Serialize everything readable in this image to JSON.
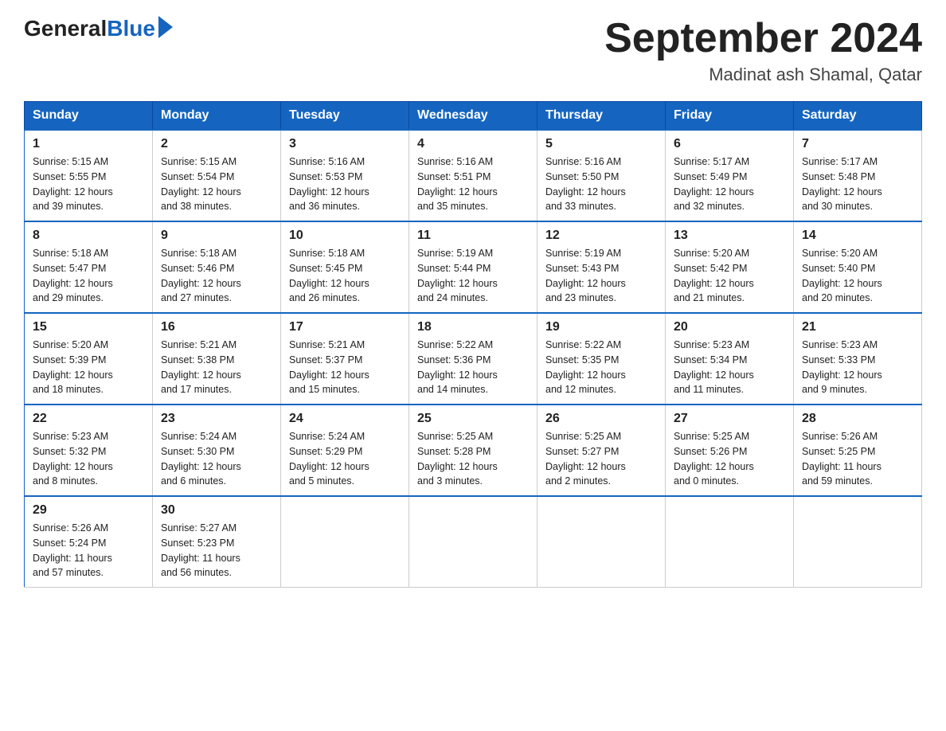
{
  "header": {
    "logo_general": "General",
    "logo_blue": "Blue",
    "month_title": "September 2024",
    "location": "Madinat ash Shamal, Qatar"
  },
  "days_of_week": [
    "Sunday",
    "Monday",
    "Tuesday",
    "Wednesday",
    "Thursday",
    "Friday",
    "Saturday"
  ],
  "weeks": [
    [
      {
        "day": "1",
        "sunrise": "5:15 AM",
        "sunset": "5:55 PM",
        "daylight": "12 hours and 39 minutes."
      },
      {
        "day": "2",
        "sunrise": "5:15 AM",
        "sunset": "5:54 PM",
        "daylight": "12 hours and 38 minutes."
      },
      {
        "day": "3",
        "sunrise": "5:16 AM",
        "sunset": "5:53 PM",
        "daylight": "12 hours and 36 minutes."
      },
      {
        "day": "4",
        "sunrise": "5:16 AM",
        "sunset": "5:51 PM",
        "daylight": "12 hours and 35 minutes."
      },
      {
        "day": "5",
        "sunrise": "5:16 AM",
        "sunset": "5:50 PM",
        "daylight": "12 hours and 33 minutes."
      },
      {
        "day": "6",
        "sunrise": "5:17 AM",
        "sunset": "5:49 PM",
        "daylight": "12 hours and 32 minutes."
      },
      {
        "day": "7",
        "sunrise": "5:17 AM",
        "sunset": "5:48 PM",
        "daylight": "12 hours and 30 minutes."
      }
    ],
    [
      {
        "day": "8",
        "sunrise": "5:18 AM",
        "sunset": "5:47 PM",
        "daylight": "12 hours and 29 minutes."
      },
      {
        "day": "9",
        "sunrise": "5:18 AM",
        "sunset": "5:46 PM",
        "daylight": "12 hours and 27 minutes."
      },
      {
        "day": "10",
        "sunrise": "5:18 AM",
        "sunset": "5:45 PM",
        "daylight": "12 hours and 26 minutes."
      },
      {
        "day": "11",
        "sunrise": "5:19 AM",
        "sunset": "5:44 PM",
        "daylight": "12 hours and 24 minutes."
      },
      {
        "day": "12",
        "sunrise": "5:19 AM",
        "sunset": "5:43 PM",
        "daylight": "12 hours and 23 minutes."
      },
      {
        "day": "13",
        "sunrise": "5:20 AM",
        "sunset": "5:42 PM",
        "daylight": "12 hours and 21 minutes."
      },
      {
        "day": "14",
        "sunrise": "5:20 AM",
        "sunset": "5:40 PM",
        "daylight": "12 hours and 20 minutes."
      }
    ],
    [
      {
        "day": "15",
        "sunrise": "5:20 AM",
        "sunset": "5:39 PM",
        "daylight": "12 hours and 18 minutes."
      },
      {
        "day": "16",
        "sunrise": "5:21 AM",
        "sunset": "5:38 PM",
        "daylight": "12 hours and 17 minutes."
      },
      {
        "day": "17",
        "sunrise": "5:21 AM",
        "sunset": "5:37 PM",
        "daylight": "12 hours and 15 minutes."
      },
      {
        "day": "18",
        "sunrise": "5:22 AM",
        "sunset": "5:36 PM",
        "daylight": "12 hours and 14 minutes."
      },
      {
        "day": "19",
        "sunrise": "5:22 AM",
        "sunset": "5:35 PM",
        "daylight": "12 hours and 12 minutes."
      },
      {
        "day": "20",
        "sunrise": "5:23 AM",
        "sunset": "5:34 PM",
        "daylight": "12 hours and 11 minutes."
      },
      {
        "day": "21",
        "sunrise": "5:23 AM",
        "sunset": "5:33 PM",
        "daylight": "12 hours and 9 minutes."
      }
    ],
    [
      {
        "day": "22",
        "sunrise": "5:23 AM",
        "sunset": "5:32 PM",
        "daylight": "12 hours and 8 minutes."
      },
      {
        "day": "23",
        "sunrise": "5:24 AM",
        "sunset": "5:30 PM",
        "daylight": "12 hours and 6 minutes."
      },
      {
        "day": "24",
        "sunrise": "5:24 AM",
        "sunset": "5:29 PM",
        "daylight": "12 hours and 5 minutes."
      },
      {
        "day": "25",
        "sunrise": "5:25 AM",
        "sunset": "5:28 PM",
        "daylight": "12 hours and 3 minutes."
      },
      {
        "day": "26",
        "sunrise": "5:25 AM",
        "sunset": "5:27 PM",
        "daylight": "12 hours and 2 minutes."
      },
      {
        "day": "27",
        "sunrise": "5:25 AM",
        "sunset": "5:26 PM",
        "daylight": "12 hours and 0 minutes."
      },
      {
        "day": "28",
        "sunrise": "5:26 AM",
        "sunset": "5:25 PM",
        "daylight": "11 hours and 59 minutes."
      }
    ],
    [
      {
        "day": "29",
        "sunrise": "5:26 AM",
        "sunset": "5:24 PM",
        "daylight": "11 hours and 57 minutes."
      },
      {
        "day": "30",
        "sunrise": "5:27 AM",
        "sunset": "5:23 PM",
        "daylight": "11 hours and 56 minutes."
      },
      null,
      null,
      null,
      null,
      null
    ]
  ],
  "labels": {
    "sunrise": "Sunrise:",
    "sunset": "Sunset:",
    "daylight": "Daylight:"
  }
}
